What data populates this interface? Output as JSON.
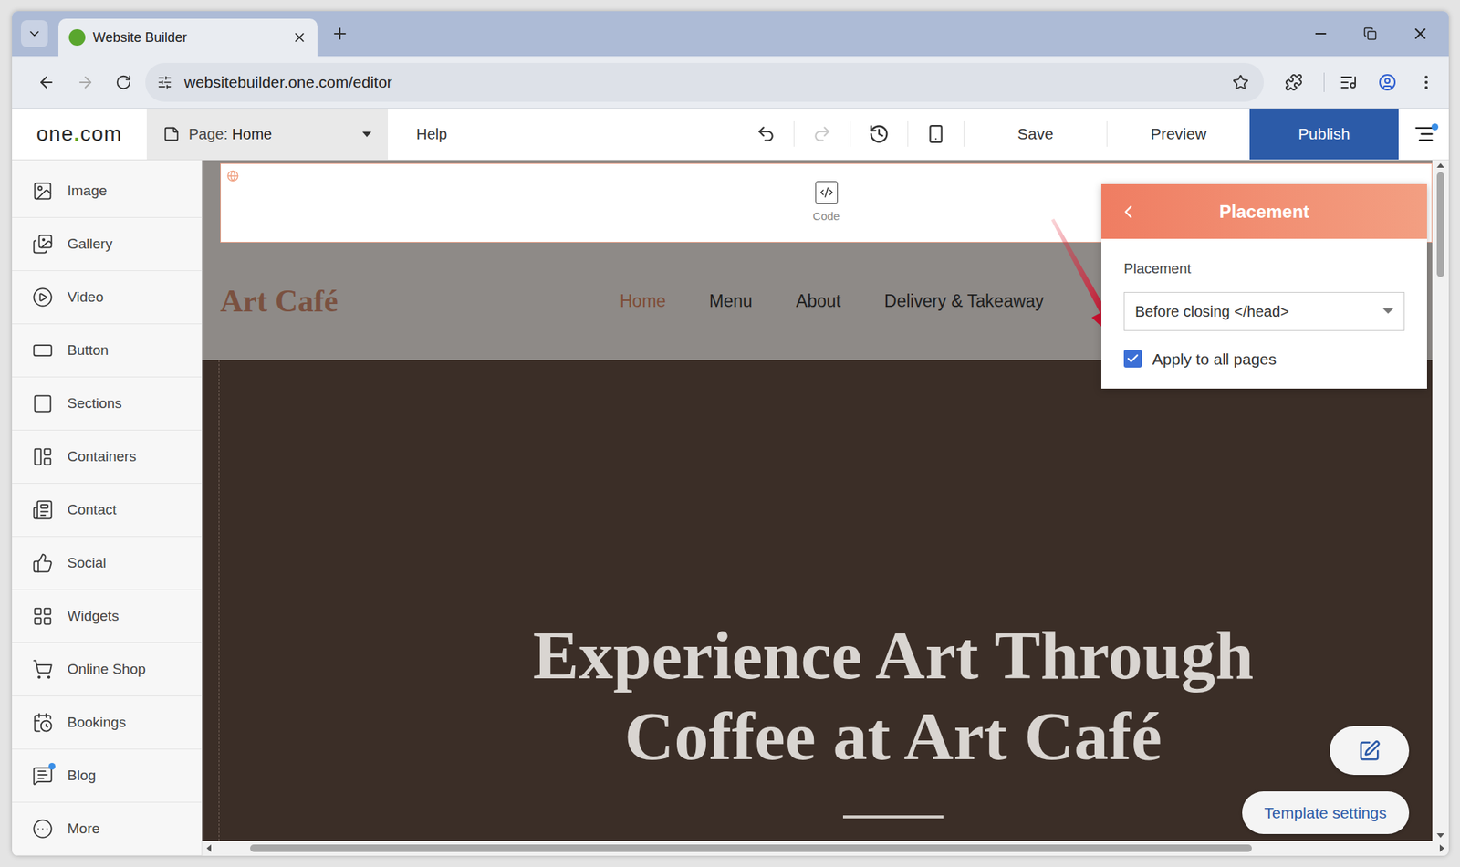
{
  "browser": {
    "tab_title": "Website Builder",
    "url": "websitebuilder.one.com/editor"
  },
  "toolbar": {
    "logo": [
      "one",
      ".",
      "com"
    ],
    "page_label": "Page:",
    "page_value": "Home",
    "help": "Help",
    "save": "Save",
    "preview": "Preview",
    "publish": "Publish",
    "undo_disabled": false,
    "redo_disabled": true,
    "menu_badge": true
  },
  "sidebar": {
    "items": [
      {
        "label": "Image",
        "badge": false
      },
      {
        "label": "Gallery",
        "badge": false
      },
      {
        "label": "Video",
        "badge": false
      },
      {
        "label": "Button",
        "badge": false
      },
      {
        "label": "Sections",
        "badge": false
      },
      {
        "label": "Containers",
        "badge": false
      },
      {
        "label": "Contact",
        "badge": false
      },
      {
        "label": "Social",
        "badge": false
      },
      {
        "label": "Widgets",
        "badge": false
      },
      {
        "label": "Online Shop",
        "badge": false
      },
      {
        "label": "Bookings",
        "badge": false
      },
      {
        "label": "Blog",
        "badge": true
      },
      {
        "label": "More",
        "badge": false
      }
    ]
  },
  "canvas": {
    "code_block": {
      "label": "Code"
    },
    "site": {
      "brand": "Art Café",
      "nav": [
        {
          "label": "Home",
          "selected": true
        },
        {
          "label": "Menu",
          "selected": false
        },
        {
          "label": "About",
          "selected": false
        },
        {
          "label": "Delivery & Takeaway",
          "selected": false
        }
      ],
      "hero": {
        "title": [
          "Experience Art Through",
          "Coffee at Art Café"
        ]
      }
    },
    "template_settings": "Template settings"
  },
  "panel": {
    "title": "Placement",
    "field_label": "Placement",
    "select_value": "Before closing </head>",
    "checkbox": {
      "label": "Apply to all pages",
      "checked": true
    }
  }
}
